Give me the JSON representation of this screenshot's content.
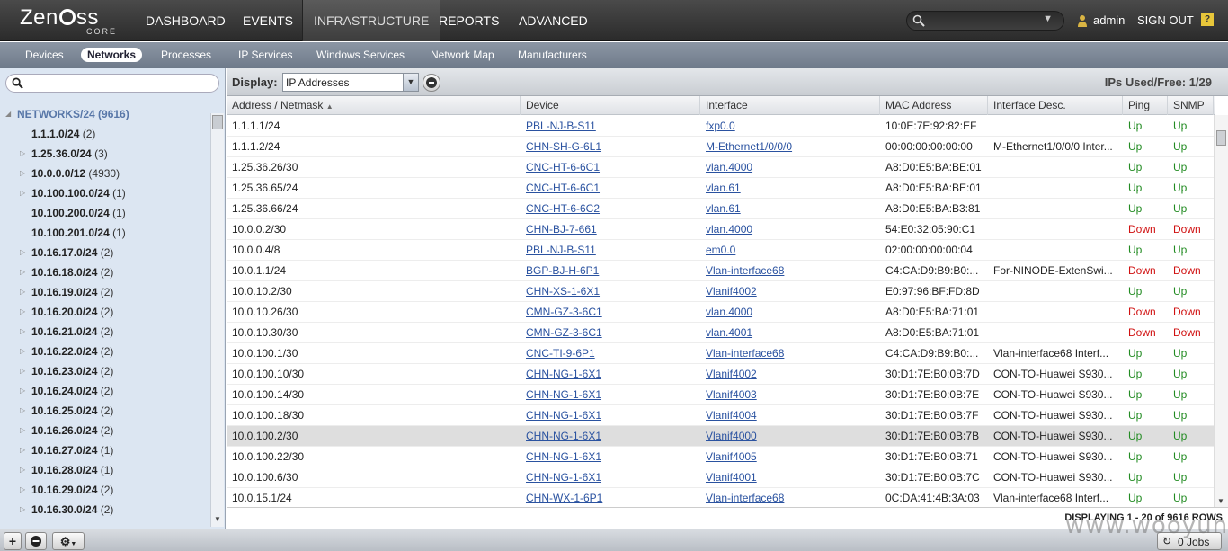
{
  "logo": {
    "word": "ZENOSS",
    "sub": "CORE"
  },
  "nav": {
    "items": [
      {
        "label": "DASHBOARD"
      },
      {
        "label": "EVENTS"
      },
      {
        "label": "INFRASTRUCTURE",
        "active": true
      },
      {
        "label": "REPORTS"
      },
      {
        "label": "ADVANCED"
      }
    ],
    "search_placeholder": "",
    "user": "admin",
    "signout": "SIGN OUT",
    "help": "?"
  },
  "subnav": {
    "items": [
      {
        "label": "Devices"
      },
      {
        "label": "Networks",
        "active": true
      },
      {
        "label": "Processes"
      },
      {
        "label": "IP Services"
      },
      {
        "label": "Windows Services"
      },
      {
        "label": "Network Map"
      },
      {
        "label": "Manufacturers"
      }
    ]
  },
  "tree": {
    "search_placeholder": "",
    "items": [
      {
        "label": "NETWORKS/24",
        "count": "(9616)",
        "root": true,
        "expanded": true
      },
      {
        "label": "1.1.1.0/24",
        "count": "(2)",
        "leaf": true
      },
      {
        "label": "1.25.36.0/24",
        "count": "(3)"
      },
      {
        "label": "10.0.0.0/12",
        "count": "(4930)"
      },
      {
        "label": "10.100.100.0/24",
        "count": "(1)"
      },
      {
        "label": "10.100.200.0/24",
        "count": "(1)",
        "leaf": true
      },
      {
        "label": "10.100.201.0/24",
        "count": "(1)",
        "leaf": true
      },
      {
        "label": "10.16.17.0/24",
        "count": "(2)"
      },
      {
        "label": "10.16.18.0/24",
        "count": "(2)"
      },
      {
        "label": "10.16.19.0/24",
        "count": "(2)"
      },
      {
        "label": "10.16.20.0/24",
        "count": "(2)"
      },
      {
        "label": "10.16.21.0/24",
        "count": "(2)"
      },
      {
        "label": "10.16.22.0/24",
        "count": "(2)"
      },
      {
        "label": "10.16.23.0/24",
        "count": "(2)"
      },
      {
        "label": "10.16.24.0/24",
        "count": "(2)"
      },
      {
        "label": "10.16.25.0/24",
        "count": "(2)"
      },
      {
        "label": "10.16.26.0/24",
        "count": "(2)"
      },
      {
        "label": "10.16.27.0/24",
        "count": "(1)"
      },
      {
        "label": "10.16.28.0/24",
        "count": "(1)"
      },
      {
        "label": "10.16.29.0/24",
        "count": "(2)"
      },
      {
        "label": "10.16.30.0/24",
        "count": "(2)"
      }
    ]
  },
  "toolbar": {
    "display_label": "Display:",
    "display_value": "IP Addresses",
    "ips_used_free": "IPs Used/Free: 1/29"
  },
  "grid": {
    "columns": [
      "Address / Netmask",
      "Device",
      "Interface",
      "MAC Address",
      "Interface Desc.",
      "Ping",
      "SNMP"
    ],
    "sort_indicator": "▲",
    "rows": [
      {
        "address": "1.1.1.1/24",
        "device": "PBL-NJ-B-S11",
        "interface": "fxp0.0",
        "mac": "10:0E:7E:92:82:EF",
        "desc": "",
        "ping": "Up",
        "snmp": "Up"
      },
      {
        "address": "1.1.1.2/24",
        "device": "CHN-SH-G-6L1",
        "interface": "M-Ethernet1/0/0/0",
        "mac": "00:00:00:00:00:00",
        "desc": "M-Ethernet1/0/0/0 Inter...",
        "ping": "Up",
        "snmp": "Up"
      },
      {
        "address": "1.25.36.26/30",
        "device": "CNC-HT-6-6C1",
        "interface": "vlan.4000",
        "mac": "A8:D0:E5:BA:BE:01",
        "desc": "",
        "ping": "Up",
        "snmp": "Up"
      },
      {
        "address": "1.25.36.65/24",
        "device": "CNC-HT-6-6C1",
        "interface": "vlan.61",
        "mac": "A8:D0:E5:BA:BE:01",
        "desc": "",
        "ping": "Up",
        "snmp": "Up"
      },
      {
        "address": "1.25.36.66/24",
        "device": "CNC-HT-6-6C2",
        "interface": "vlan.61",
        "mac": "A8:D0:E5:BA:B3:81",
        "desc": "",
        "ping": "Up",
        "snmp": "Up"
      },
      {
        "address": "10.0.0.2/30",
        "device": "CHN-BJ-7-661",
        "interface": "vlan.4000",
        "mac": "54:E0:32:05:90:C1",
        "desc": "",
        "ping": "Down",
        "snmp": "Down"
      },
      {
        "address": "10.0.0.4/8",
        "device": "PBL-NJ-B-S11",
        "interface": "em0.0",
        "mac": "02:00:00:00:00:04",
        "desc": "",
        "ping": "Up",
        "snmp": "Up"
      },
      {
        "address": "10.0.1.1/24",
        "device": "BGP-BJ-H-6P1",
        "interface": "Vlan-interface68",
        "mac": "C4:CA:D9:B9:B0:...",
        "desc": "For-NINODE-ExtenSwi...",
        "ping": "Down",
        "snmp": "Down"
      },
      {
        "address": "10.0.10.2/30",
        "device": "CHN-XS-1-6X1",
        "interface": "Vlanif4002",
        "mac": "E0:97:96:BF:FD:8D",
        "desc": "",
        "ping": "Up",
        "snmp": "Up"
      },
      {
        "address": "10.0.10.26/30",
        "device": "CMN-GZ-3-6C1",
        "interface": "vlan.4000",
        "mac": "A8:D0:E5:BA:71:01",
        "desc": "",
        "ping": "Down",
        "snmp": "Down"
      },
      {
        "address": "10.0.10.30/30",
        "device": "CMN-GZ-3-6C1",
        "interface": "vlan.4001",
        "mac": "A8:D0:E5:BA:71:01",
        "desc": "",
        "ping": "Down",
        "snmp": "Down"
      },
      {
        "address": "10.0.100.1/30",
        "device": "CNC-TI-9-6P1",
        "interface": "Vlan-interface68",
        "mac": "C4:CA:D9:B9:B0:...",
        "desc": "Vlan-interface68 Interf...",
        "ping": "Up",
        "snmp": "Up"
      },
      {
        "address": "10.0.100.10/30",
        "device": "CHN-NG-1-6X1",
        "interface": "Vlanif4002",
        "mac": "30:D1:7E:B0:0B:7D",
        "desc": "CON-TO-Huawei S930...",
        "ping": "Up",
        "snmp": "Up"
      },
      {
        "address": "10.0.100.14/30",
        "device": "CHN-NG-1-6X1",
        "interface": "Vlanif4003",
        "mac": "30:D1:7E:B0:0B:7E",
        "desc": "CON-TO-Huawei S930...",
        "ping": "Up",
        "snmp": "Up"
      },
      {
        "address": "10.0.100.18/30",
        "device": "CHN-NG-1-6X1",
        "interface": "Vlanif4004",
        "mac": "30:D1:7E:B0:0B:7F",
        "desc": "CON-TO-Huawei S930...",
        "ping": "Up",
        "snmp": "Up"
      },
      {
        "address": "10.0.100.2/30",
        "device": "CHN-NG-1-6X1",
        "interface": "Vlanif4000",
        "mac": "30:D1:7E:B0:0B:7B",
        "desc": "CON-TO-Huawei S930...",
        "ping": "Up",
        "snmp": "Up",
        "selected": true
      },
      {
        "address": "10.0.100.22/30",
        "device": "CHN-NG-1-6X1",
        "interface": "Vlanif4005",
        "mac": "30:D1:7E:B0:0B:71",
        "desc": "CON-TO-Huawei S930...",
        "ping": "Up",
        "snmp": "Up"
      },
      {
        "address": "10.0.100.6/30",
        "device": "CHN-NG-1-6X1",
        "interface": "Vlanif4001",
        "mac": "30:D1:7E:B0:0B:7C",
        "desc": "CON-TO-Huawei S930...",
        "ping": "Up",
        "snmp": "Up"
      },
      {
        "address": "10.0.15.1/24",
        "device": "CHN-WX-1-6P1",
        "interface": "Vlan-interface68",
        "mac": "0C:DA:41:4B:3A:03",
        "desc": "Vlan-interface68 Interf...",
        "ping": "Up",
        "snmp": "Up"
      }
    ],
    "rows_info": "DISPLAYING 1 - 20 of 9616 ROWS"
  },
  "bottombar": {
    "add": "+",
    "jobs": "0 Jobs"
  },
  "watermark": "www.wooyun.org",
  "colors": {
    "up": "#228b22",
    "down": "#d01010",
    "link": "#2a52a0",
    "root": "#5877a8"
  }
}
